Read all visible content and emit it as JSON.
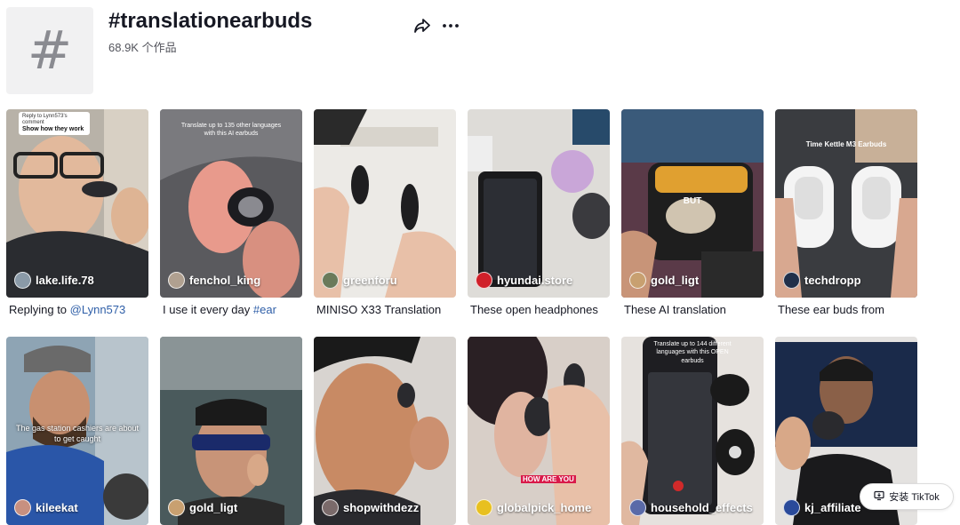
{
  "header": {
    "avatar_symbol": "#",
    "title": "#translationearbuds",
    "count": "68.9K 个作品",
    "share_icon": "share-arrow-icon",
    "more_icon": "more-dots-icon"
  },
  "videos": [
    {
      "user": "lake.life.78",
      "caption": "Replying to ",
      "caption_link": "@Lynn573",
      "overlay": "Show how they work",
      "overlay_small": "Reply to Lynn573's comment",
      "avatar_color": "#8a9aa8"
    },
    {
      "user": "fenchol_king",
      "caption": "I use it every day ",
      "caption_link": "#ear",
      "overlay": "Translate up to 135 other languages with this AI earbuds",
      "avatar_color": "#b0a090"
    },
    {
      "user": "greenforu",
      "caption": "MINISO X33 Translation",
      "caption_link": "",
      "overlay": "",
      "avatar_color": "#6a7a5a"
    },
    {
      "user": "hyundai.store",
      "caption": "These open headphones",
      "caption_link": "",
      "overlay": "",
      "avatar_color": "#d0202a"
    },
    {
      "user": "gold_ligt",
      "caption": "These AI translation",
      "caption_link": "",
      "overlay": "BUT",
      "avatar_color": "#c8a070"
    },
    {
      "user": "techdropp",
      "caption": "These ear buds from",
      "caption_link": "",
      "overlay": "Time Kettle M3 Earbuds",
      "avatar_color": "#20304a"
    },
    {
      "user": "kileekat",
      "caption": "",
      "caption_link": "",
      "overlay": "The gas station cashiers are about to get caught",
      "avatar_color": "#c89080"
    },
    {
      "user": "gold_ligt",
      "caption": "",
      "caption_link": "",
      "overlay": "",
      "avatar_color": "#c8a070"
    },
    {
      "user": "shopwithdezz",
      "caption": "",
      "caption_link": "",
      "overlay": "",
      "avatar_color": "#7a6a6a"
    },
    {
      "user": "globalpick_home",
      "caption": "",
      "caption_link": "",
      "overlay": "HOW ARE YOU",
      "avatar_color": "#e8c020"
    },
    {
      "user": "household_effects",
      "caption": "",
      "caption_link": "",
      "overlay": "Translate up to 144 different languages with this OPEN earbuds",
      "avatar_color": "#5a6aa8"
    },
    {
      "user": "kj_affiliate",
      "caption": "",
      "caption_link": "",
      "overlay": "",
      "avatar_color": "#2a4a9a"
    }
  ],
  "install_button": {
    "label": "安装 TikTok",
    "icon": "desktop-app-icon"
  }
}
